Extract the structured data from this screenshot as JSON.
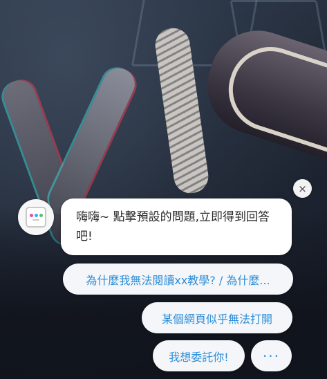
{
  "chat": {
    "close_icon": "×",
    "avatar_icon": "robot-icon",
    "greeting": "嗨嗨~ 點擊預設的問題,立即得到回答吧!",
    "suggestions": [
      {
        "label": "為什麼我無法閱讀xx教學? / 為什麼..."
      },
      {
        "label": "某個網頁似乎無法打開"
      },
      {
        "label": "我想委託你!"
      }
    ],
    "more_label": "···"
  },
  "colors": {
    "accent": "#2e8ed8",
    "chip_bg": "#f4f6f9",
    "bot_dot_1": "#e84aa8",
    "bot_dot_2": "#3fa9f5",
    "bot_dot_3": "#55c26b"
  }
}
